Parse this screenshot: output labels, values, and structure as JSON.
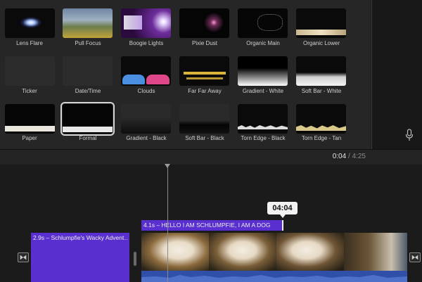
{
  "titles": [
    {
      "label": "Lens Flare"
    },
    {
      "label": "Pull Focus"
    },
    {
      "label": "Boogie Lights"
    },
    {
      "label": "Pixie Dust"
    },
    {
      "label": "Organic Main"
    },
    {
      "label": "Organic Lower"
    },
    {
      "label": "Ticker"
    },
    {
      "label": "Date/Time"
    },
    {
      "label": "Clouds"
    },
    {
      "label": "Far Far Away"
    },
    {
      "label": "Gradient - White"
    },
    {
      "label": "Soft Bar - White"
    },
    {
      "label": "Paper"
    },
    {
      "label": "Formal"
    },
    {
      "label": "Gradient - Black"
    },
    {
      "label": "Soft Bar - Black"
    },
    {
      "label": "Torn Edge - Black"
    },
    {
      "label": "Torn Edge - Tan"
    }
  ],
  "timecode": {
    "current": "0:04",
    "separator": "/",
    "total": "4:25"
  },
  "skim_time": "04:04",
  "clips": {
    "title_clip": "2.9s – Schlumpfie's Wacky Advent…",
    "caption_clip": "4.1s – HELLO I AM SCHLUMPFIE, I AM A DOG"
  },
  "colors": {
    "clip": "#5a2fcf",
    "audio": "#2f4fa8"
  }
}
